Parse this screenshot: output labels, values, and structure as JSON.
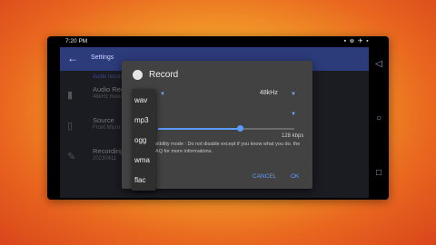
{
  "statusbar": {
    "time": "7:20 PM",
    "icons": "▪ ⊗ ✈ ▪ ▮"
  },
  "appbar": {
    "back_icon": "arrow-left-icon",
    "title": "Settings"
  },
  "section_label": "Audio recording",
  "settings_items": [
    {
      "icon": "file-icon",
      "title": "Audio Rec",
      "subtitle": "48kHz mono"
    },
    {
      "icon": "phone-icon",
      "title": "Source",
      "subtitle": "Front Micro"
    },
    {
      "icon": "pencil-icon",
      "title": "Recording",
      "subtitle": "20230411"
    }
  ],
  "dialog": {
    "title": "Record",
    "sample_rate": "48kHz",
    "bitrate_label": "128 kbps",
    "bitrate_fraction": 0.6,
    "compat_text": "ratibility mode : Do not disable except if you know what you do. the FAQ for more informations.",
    "cancel": "CANCEL",
    "ok": "OK"
  },
  "format_options": [
    "wav",
    "mp3",
    "ogg",
    "wma",
    "flac"
  ],
  "nav": {
    "back": "◁",
    "home": "○",
    "recent": "□"
  }
}
